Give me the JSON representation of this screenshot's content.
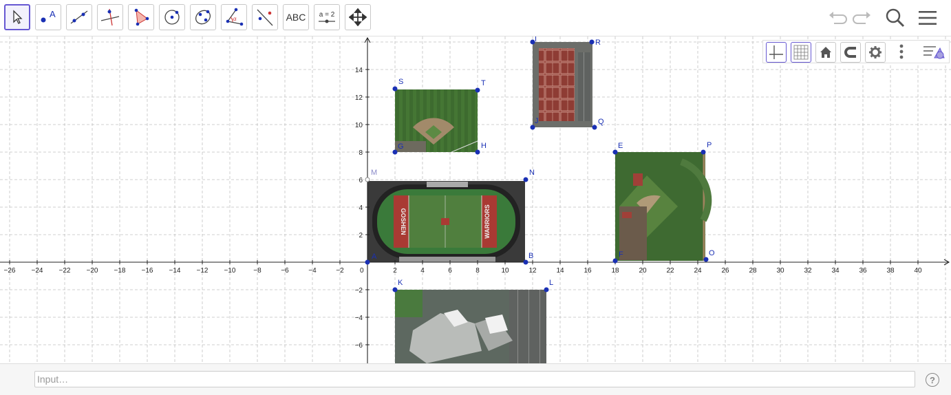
{
  "toolbar": {
    "tools": [
      {
        "name": "move-tool",
        "icon": "pointer-icon"
      },
      {
        "name": "point-tool",
        "icon": "point-icon",
        "label": "A"
      },
      {
        "name": "line-tool",
        "icon": "line-icon"
      },
      {
        "name": "perpendicular-line-tool",
        "icon": "perpendicular-icon"
      },
      {
        "name": "polygon-tool",
        "icon": "polygon-icon"
      },
      {
        "name": "circle-center-point-tool",
        "icon": "circle-icon"
      },
      {
        "name": "ellipse-tool",
        "icon": "ellipse-icon"
      },
      {
        "name": "angle-tool",
        "icon": "angle-icon"
      },
      {
        "name": "reflect-tool",
        "icon": "reflect-icon"
      },
      {
        "name": "text-tool",
        "icon": "text-icon",
        "label": "ABC"
      },
      {
        "name": "slider-tool",
        "icon": "slider-icon",
        "label": "a = 2"
      },
      {
        "name": "move-graphics-view-tool",
        "icon": "move-arrows-icon"
      }
    ],
    "active_tool": "move-tool"
  },
  "graphics_style_bar": {
    "buttons": [
      "axes-toggle",
      "grid-toggle",
      "home",
      "magnet-snap",
      "settings",
      "more"
    ]
  },
  "axes": {
    "x_ticks": [
      "−26",
      "−24",
      "−22",
      "−20",
      "−18",
      "−16",
      "−14",
      "−12",
      "−10",
      "−8",
      "−6",
      "−4",
      "−2",
      "0",
      "2",
      "4",
      "6",
      "8",
      "10",
      "12",
      "14",
      "16",
      "18",
      "20",
      "22",
      "24",
      "26",
      "28",
      "30",
      "32",
      "34",
      "36",
      "38",
      "40"
    ],
    "y_ticks": [
      "14",
      "12",
      "10",
      "8",
      "6",
      "4",
      "2",
      "−2",
      "−4",
      "−6"
    ]
  },
  "points": [
    {
      "label": "A"
    },
    {
      "label": "B"
    },
    {
      "label": "M"
    },
    {
      "label": "N"
    },
    {
      "label": "S"
    },
    {
      "label": "T"
    },
    {
      "label": "G"
    },
    {
      "label": "H"
    },
    {
      "label": "I"
    },
    {
      "label": "R"
    },
    {
      "label": "J"
    },
    {
      "label": "Q"
    },
    {
      "label": "E"
    },
    {
      "label": "P"
    },
    {
      "label": "F"
    },
    {
      "label": "O"
    },
    {
      "label": "K"
    },
    {
      "label": "L"
    }
  ],
  "images": {
    "football_left_text": "GOSHEN",
    "football_right_text": "WARRIORS"
  },
  "input_bar": {
    "placeholder": "Input…",
    "help": "?"
  },
  "colors": {
    "point": "#1a30b4",
    "accent": "#6557d2",
    "grid": "#c0c0c0"
  }
}
